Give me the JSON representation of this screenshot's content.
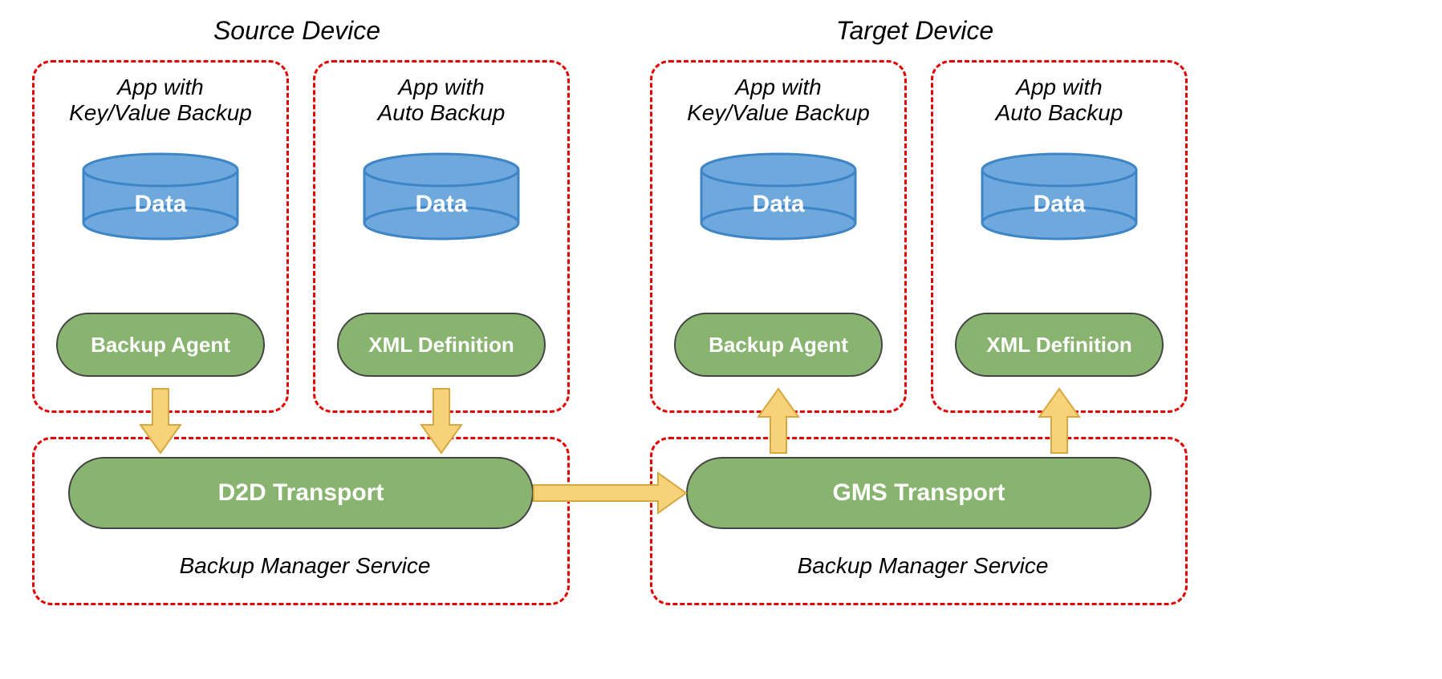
{
  "titles": {
    "source": "Source Device",
    "target": "Target Device"
  },
  "apps": {
    "kv_title_line1": "App with",
    "kv_title_line2": "Key/Value Backup",
    "auto_title_line1": "App with",
    "auto_title_line2": "Auto Backup"
  },
  "labels": {
    "data": "Data",
    "backup_agent": "Backup Agent",
    "xml_definition": "XML Definition",
    "d2d_transport": "D2D Transport",
    "gms_transport": "GMS Transport",
    "bms": "Backup Manager Service"
  },
  "colors": {
    "dashed_border": "#e60000",
    "cylinder_fill": "#6fa8dc",
    "cylinder_stroke": "#3d85c6",
    "pill_fill": "#88b46f",
    "arrow_fill": "#f6d27a",
    "arrow_stroke": "#d6a840"
  }
}
